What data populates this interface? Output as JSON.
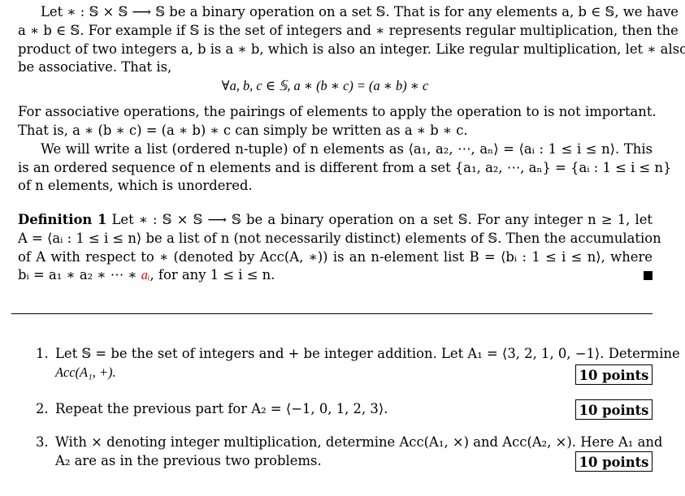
{
  "intro": {
    "line1": "Let ∗ : 𝕊 × 𝕊 ⟶ 𝕊 be a binary operation on a set 𝕊. That is for any elements a, b ∈ 𝕊, we have",
    "line2": "a ∗ b ∈ 𝕊. For example if 𝕊 is the set of integers and ∗ represents regular multiplication, then the",
    "line3": "product of two integers a, b is a ∗ b, which is also an integer. Like regular multiplication, let ∗ also",
    "line4": "be associative. That is,",
    "equation": "∀a, b, c ∈ 𝕊,   a ∗ (b ∗ c) = (a ∗ b) ∗ c",
    "line5": "For associative operations, the pairings of elements to apply the operation to is not important.",
    "line6": "That is, a ∗ (b ∗ c) = (a ∗ b) ∗ c can simply be written as a ∗ b ∗ c.",
    "line7": "We will write a list (ordered n-tuple) of n elements as ⟨a₁, a₂, ⋯, aₙ⟩ = ⟨aᵢ : 1 ≤ i ≤ n⟩. This",
    "line8": "is an ordered sequence of n elements and is different from a set {a₁, a₂, ⋯, aₙ} = {aᵢ : 1 ≤ i ≤ n}",
    "line9": "of n elements, which is unordered."
  },
  "definition": {
    "label": "Definition 1",
    "line1_rest": "Let ∗ : 𝕊 × 𝕊 ⟶ 𝕊 be a binary operation on a set 𝕊. For any integer n ≥ 1, let",
    "line2": "A = ⟨aᵢ : 1 ≤ i ≤ n⟩ be a list of n (not necessarily distinct) elements of 𝕊. Then the accumulation",
    "line3": "of A with respect to ∗ (denoted by Acc(A, ∗)) is an n-element list B = ⟨bᵢ : 1 ≤ i ≤ n⟩, where",
    "line4_pre": "bᵢ = a₁ ∗ a₂ ∗ ⋯ ∗ ",
    "line4_red": "aᵢ",
    "line4_post": ", for any 1 ≤ i ≤ n.",
    "highlight_color": "#e00000"
  },
  "problems": [
    {
      "number": "1.",
      "line1": "Let 𝕊 = be the set of integers and + be integer addition. Let A₁ = ⟨3, 2, 1, 0, −1⟩. Determine",
      "line2": "Acc(A₁, +).",
      "points": "10 points"
    },
    {
      "number": "2.",
      "line1": "Repeat the previous part for A₂ = ⟨−1, 0, 1, 2, 3⟩.",
      "points": "10 points"
    },
    {
      "number": "3.",
      "line1": "With × denoting integer multiplication, determine Acc(A₁, ×) and Acc(A₂, ×). Here A₁ and",
      "line2": "A₂ are as in the previous two problems.",
      "points": "10 points"
    }
  ]
}
